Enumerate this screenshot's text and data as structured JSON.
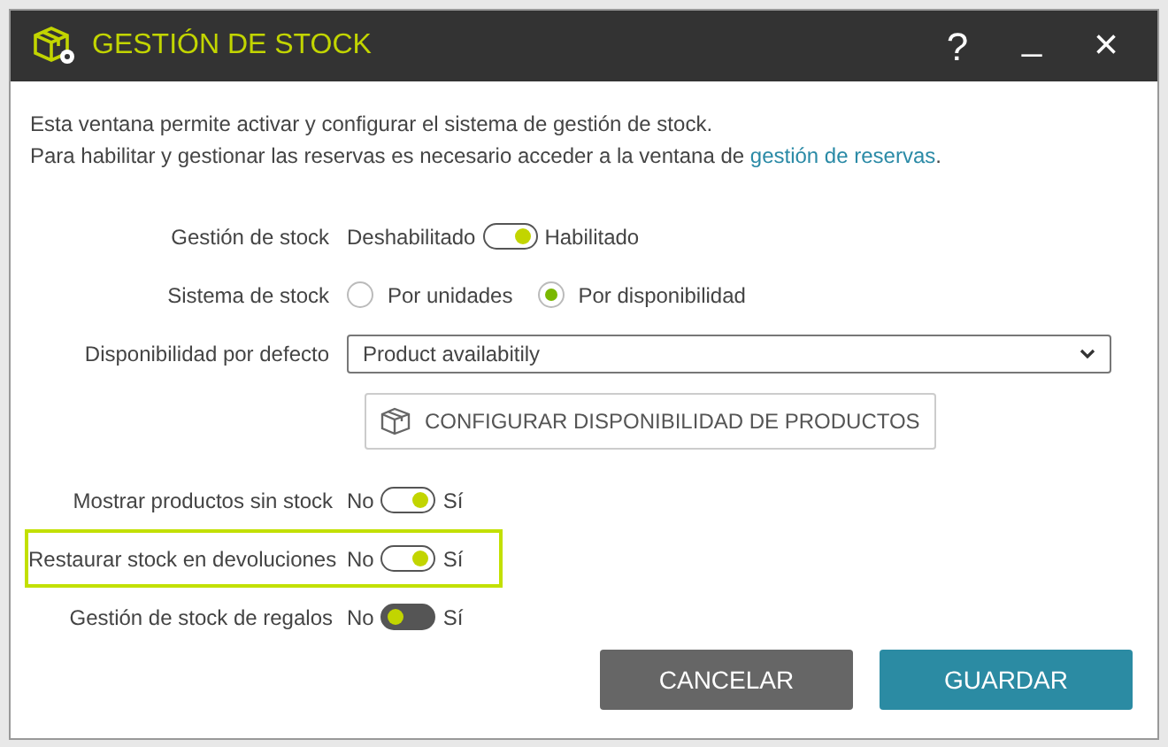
{
  "window": {
    "title": "GESTIÓN DE STOCK",
    "help": "?",
    "minimize": "_",
    "close": "×"
  },
  "intro": {
    "line_1": "Esta ventana permite activar y configurar el sistema de gestión de stock.",
    "line_2": "Para habilitar y gestionar las reservas es necesario acceder a la ventana de",
    "link": "gestión de reservas",
    "end": "."
  },
  "stock_management": {
    "label": "Gestión de stock",
    "off_label": "Deshabilitado",
    "on_label": "Habilitado",
    "on": true
  },
  "stock_system": {
    "label": "Sistema de stock",
    "options": [
      {
        "label": "Por unidades",
        "selected": false
      },
      {
        "label": "Por disponibilidad",
        "selected": true
      }
    ]
  },
  "default_availability": {
    "label": "Disponibilidad por defecto",
    "value": "Product availabitily"
  },
  "configure_button": "CONFIGURAR DISPONIBILIDAD DE PRODUCTOS",
  "switches": [
    {
      "label": "Mostrar productos sin stock",
      "off_label": "No",
      "on_label": "Sí",
      "on": true,
      "highlighted": false
    },
    {
      "label": "Restaurar stock en devoluciones",
      "off_label": "No",
      "on_label": "Sí",
      "on": true,
      "highlighted": true
    },
    {
      "label": "Gestión de stock de regalos",
      "off_label": "No",
      "on_label": "Sí",
      "on": false,
      "highlighted": false
    }
  ],
  "buttons": [
    {
      "label": "CANCELAR",
      "kind": "secondary"
    },
    {
      "label": "GUARDAR",
      "kind": "primary"
    }
  ]
}
